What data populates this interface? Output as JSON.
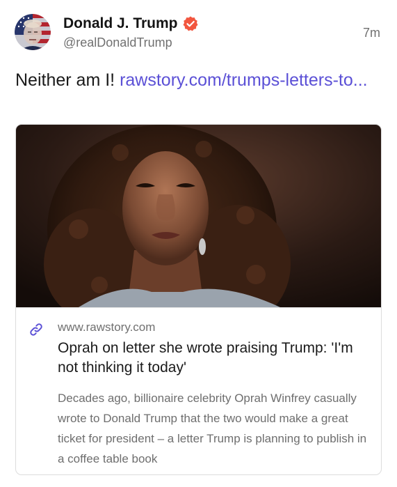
{
  "post": {
    "author": {
      "display_name": "Donald J. Trump",
      "handle": "@realDonaldTrump",
      "verified": true
    },
    "time": "7m",
    "text_prefix": "Neither am I! ",
    "link_text": "rawstory.com/trumps-letters-to..."
  },
  "card": {
    "domain": "www.rawstory.com",
    "title": "Oprah on letter she wrote praising Trump: 'I'm not thinking it today'",
    "description": "Decades ago, billionaire celebrity Oprah Winfrey casually wrote to Donald Trump that the two would make a great ticket for president – a letter Trump is planning to publish in a coffee table book"
  },
  "colors": {
    "link": "#5b50d6",
    "verified_badge": "#f2563f",
    "secondary_text": "#707070"
  },
  "icons": {
    "verified": "verified-badge-icon",
    "link": "link-icon"
  }
}
